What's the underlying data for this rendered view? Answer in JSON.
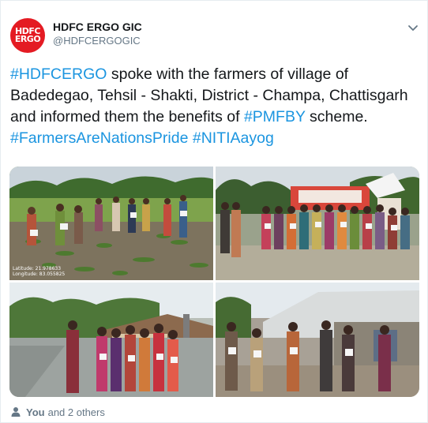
{
  "author": {
    "display_name": "HDFC ERGO GIC",
    "handle": "@HDFCERGOGIC",
    "avatar_text": [
      "HDFC",
      "ERGO"
    ],
    "avatar_color": "#e41b23"
  },
  "tweet": {
    "hashtag_hdfcergo": "#HDFCERGO",
    "text_part1": " spoke with the farmers of village of Badedegao, Tehsil - Shakti, District - Champa, Chattisgarh  and informed them the benefits of ",
    "hashtag_pmfby": "#PMFBY",
    "text_part2": " scheme. ",
    "hashtag_farmers": "#FarmersAreNationsPride",
    "hashtag_niti": "#NITIAayog",
    "link_color": "#1b95e0"
  },
  "photos": {
    "photo1_latitude": "Latitude: 21.978633",
    "photo1_longitude": "Longitude: 83.055825"
  },
  "footer": {
    "you_label": "You",
    "others_label": "and 2 others",
    "icon": "person-icon"
  },
  "menu": {
    "icon": "chevron-down-icon"
  }
}
